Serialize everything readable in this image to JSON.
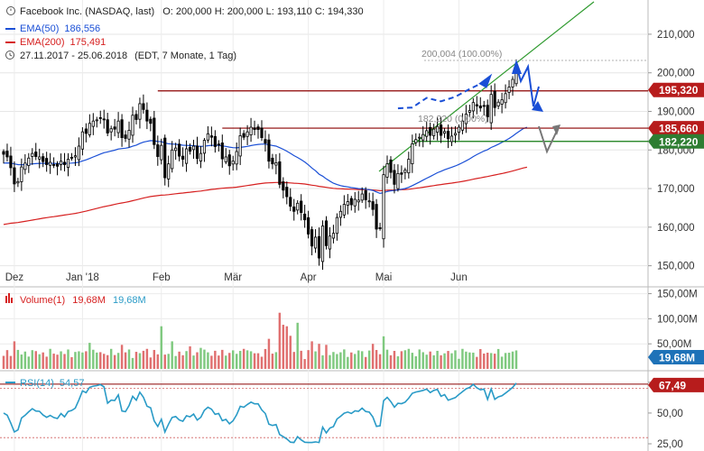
{
  "header": {
    "title": "Facebook Inc. (NASDAQ, last)",
    "ohlc": "O: 200,000  H: 200,000  L: 193,110  C: 194,330",
    "ema50_label": "EMA(50)",
    "ema50_value": "186,556",
    "ema200_label": "EMA(200)",
    "ema200_value": "175,491",
    "date_range": "27.11.2017 - 25.06.2018",
    "date_note": "(EDT, 7 Monate, 1 Tag)"
  },
  "colors": {
    "candle_up": "#ffffff",
    "candle_down": "#000000",
    "ema50": "#1a4fd6",
    "ema200": "#d62020",
    "resistance": "#8b0000",
    "support": "#117a11",
    "trendline": "#2e9a2e",
    "forecast_blue": "#1a4fd6",
    "forecast_grey": "#777777",
    "vol_up": "#7fc97f",
    "vol_down": "#e07070",
    "rsi": "#2a9bc7",
    "badge_red": "#b71c1c",
    "badge_green": "#2e7d32",
    "badge_blue": "#1e72b8"
  },
  "chart_data": {
    "type": "candlestick",
    "price_axis": {
      "min": 145,
      "max": 217,
      "ticks": [
        "210,000",
        "200,000",
        "190,000",
        "180,000",
        "170,000",
        "160,000",
        "150,000"
      ],
      "tick_values": [
        210,
        200,
        190,
        180,
        170,
        160,
        150
      ]
    },
    "x_labels": [
      "Dez",
      "Jan '18",
      "Feb",
      "Mär",
      "Apr",
      "Mai",
      "Jun"
    ],
    "x_label_bars": [
      3,
      22,
      44,
      64,
      85,
      106,
      127
    ],
    "bar_count": 144,
    "closes": [
      178.9,
      178.2,
      175.4,
      171.2,
      171.8,
      175.6,
      176.6,
      177.9,
      179.1,
      178.3,
      178.2,
      177.0,
      176.2,
      176.8,
      176.1,
      175.8,
      177.1,
      176.2,
      177.6,
      177.9,
      178.5,
      181.0,
      184.7,
      184.3,
      186.9,
      187.5,
      187.8,
      188.3,
      187.9,
      184.4,
      185.5,
      185.4,
      187.5,
      183.2,
      183.0,
      185.1,
      189.0,
      187.9,
      192.0,
      190.5,
      187.5,
      186.9,
      181.4,
      178.3,
      181.2,
      172.8,
      176.4,
      180.0,
      180.5,
      178.4,
      177.6,
      180.3,
      179.7,
      181.0,
      177.8,
      179.1,
      182.5,
      184.2,
      183.3,
      180.9,
      181.3,
      177.7,
      178.2,
      175.9,
      177.1,
      179.6,
      183.7,
      183.3,
      184.7,
      185.9,
      185.3,
      185.3,
      183.2,
      181.8,
      177.1,
      176.4,
      176.7,
      171.1,
      169.6,
      167.9,
      165.4,
      164.1,
      166.2,
      163.8,
      161.9,
      158.2,
      155.1,
      157.4,
      152.0,
      160.3,
      155.2,
      157.7,
      158.4,
      162.5,
      164.1,
      165.9,
      166.6,
      165.8,
      167.2,
      167.0,
      168.6,
      167.1,
      166.8,
      164.6,
      159.5,
      159.7,
      173.6,
      176.4,
      174.2,
      171.1,
      173.9,
      173.7,
      174.8,
      177.6,
      181.6,
      182.7,
      183.3,
      184.0,
      185.0,
      183.8,
      185.4,
      186.1,
      183.8,
      184.8,
      182.9,
      183.6,
      184.3,
      185.9,
      187.5,
      189.3,
      190.2,
      192.3,
      191.4,
      190.9,
      191.3,
      188.6,
      194.4,
      191.0,
      192.4,
      193.0,
      194.6,
      196.3,
      198.3,
      201.4,
      201.4,
      200.0,
      194.3
    ],
    "volume_axis": {
      "max_m": 150,
      "ticks": [
        "150,00M",
        "100,00M",
        "50,00M"
      ],
      "tick_values": [
        150,
        100,
        50
      ]
    },
    "volume_last": "19,68M",
    "rsi_axis": {
      "min": 25,
      "max": 80,
      "ticks": [
        "75,00",
        "50,00",
        "25,00"
      ],
      "tick_values": [
        75,
        50,
        25
      ]
    },
    "rsi_label": "RSI(14)",
    "rsi_value": "54,57",
    "rsi_badge": "67,49",
    "volume_label": "Volume(1)",
    "volume_value1": "19,68M",
    "volume_value2": "19,68M",
    "levels": [
      {
        "value": 195.32,
        "label": "195,320",
        "kind": "resistance"
      },
      {
        "value": 185.66,
        "label": "185,660",
        "kind": "resistance"
      },
      {
        "value": 182.22,
        "label": "182,220",
        "kind": "support"
      }
    ],
    "annotations": {
      "high_label": "200,004 (100.00%)",
      "low_label": "182,220 (0.00%)"
    }
  }
}
